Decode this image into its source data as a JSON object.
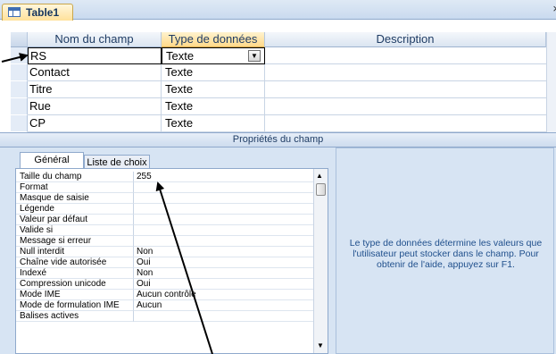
{
  "window": {
    "tab_title": "Table1",
    "close_glyph": "×"
  },
  "grid": {
    "headers": {
      "name": "Nom du champ",
      "type": "Type de données",
      "description": "Description"
    },
    "rows": [
      {
        "name": "RS",
        "type": "Texte",
        "description": ""
      },
      {
        "name": "Contact",
        "type": "Texte",
        "description": ""
      },
      {
        "name": "Titre",
        "type": "Texte",
        "description": ""
      },
      {
        "name": "Rue",
        "type": "Texte",
        "description": ""
      },
      {
        "name": "CP",
        "type": "Texte",
        "description": ""
      }
    ],
    "combo_arrow": "▼"
  },
  "properties": {
    "section_title": "Propriétés du champ",
    "tabs": {
      "general": "Général",
      "lookup": "Liste de choix"
    },
    "items": [
      {
        "label": "Taille du champ",
        "value": "255"
      },
      {
        "label": "Format",
        "value": ""
      },
      {
        "label": "Masque de saisie",
        "value": ""
      },
      {
        "label": "Légende",
        "value": ""
      },
      {
        "label": "Valeur par défaut",
        "value": ""
      },
      {
        "label": "Valide si",
        "value": ""
      },
      {
        "label": "Message si erreur",
        "value": ""
      },
      {
        "label": "Null interdit",
        "value": "Non"
      },
      {
        "label": "Chaîne vide autorisée",
        "value": "Oui"
      },
      {
        "label": "Indexé",
        "value": "Non"
      },
      {
        "label": "Compression unicode",
        "value": "Oui"
      },
      {
        "label": "Mode IME",
        "value": "Aucun contrôle"
      },
      {
        "label": "Mode de formulation IME",
        "value": "Aucun"
      },
      {
        "label": "Balises actives",
        "value": ""
      }
    ],
    "scroll_up": "▲",
    "scroll_down": "▼",
    "help_text": "Le type de données détermine les valeurs que l'utilisateur peut stocker dans le champ. Pour obtenir de l'aide, appuyez sur F1."
  },
  "colors": {
    "accent": "#ffd98a",
    "panel": "#d7e4f3",
    "help_text": "#1f4f8c"
  }
}
